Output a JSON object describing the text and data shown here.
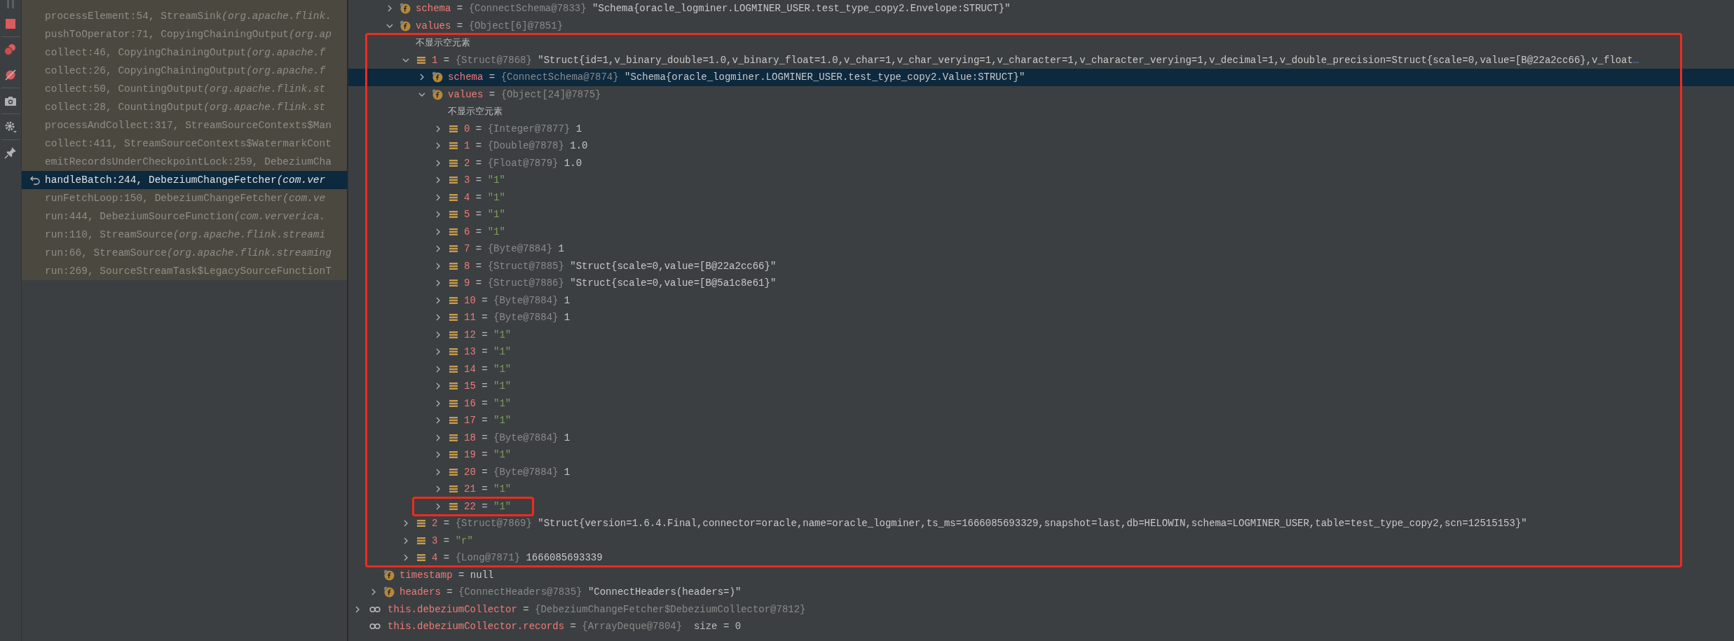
{
  "frames": [
    {
      "method": "processElement:54, StreamSink ",
      "package": "(org.apache.flink.",
      "selected": false
    },
    {
      "method": "pushToOperator:71, CopyingChainingOutput ",
      "package": "(org.ap",
      "selected": false
    },
    {
      "method": "collect:46, CopyingChainingOutput ",
      "package": "(org.apache.f",
      "selected": false
    },
    {
      "method": "collect:26, CopyingChainingOutput ",
      "package": "(org.apache.f",
      "selected": false
    },
    {
      "method": "collect:50, CountingOutput ",
      "package": "(org.apache.flink.st",
      "selected": false
    },
    {
      "method": "collect:28, CountingOutput ",
      "package": "(org.apache.flink.st",
      "selected": false
    },
    {
      "method": "processAndCollect:317, StreamSourceContexts$Man",
      "selected": false
    },
    {
      "method": "collect:411, StreamSourceContexts$WatermarkCont",
      "selected": false
    },
    {
      "method": "emitRecordsUnderCheckpointLock:259, DebeziumCha",
      "selected": false
    },
    {
      "method": "handleBatch:244, DebeziumChangeFetcher ",
      "package": "(com.ver",
      "selected": true
    },
    {
      "method": "runFetchLoop:150, DebeziumChangeFetcher ",
      "package": "(com.ve",
      "selected": false
    },
    {
      "method": "run:444, DebeziumSourceFunction ",
      "package": "(com.ververica.",
      "selected": false
    },
    {
      "method": "run:110, StreamSource ",
      "package": "(org.apache.flink.streami",
      "selected": false
    },
    {
      "method": "run:66, StreamSource ",
      "package": "(org.apache.flink.streaming",
      "selected": false
    },
    {
      "method": "run:269, SourceStreamTask$LegacySourceFunctionT",
      "selected": false
    }
  ],
  "value_fields": [
    {
      "kind": "field",
      "name": "schema",
      "sep": "=",
      "ref": "{ConnectSchema@7833}",
      "value": "\"Schema{oracle_logminer.LOGMINER_USER.test_type_copy2.Envelope:STRUCT}\"",
      "literal": false,
      "expanded": false,
      "selected": false
    },
    {
      "kind": "field",
      "name": "values",
      "sep": "=",
      "ref": "{Object[6]@7851}",
      "expanded": true,
      "selected": false,
      "note": "不显示空元素",
      "children": [
        {
          "kind": "element",
          "name": "1",
          "sep": "=",
          "ref": "{Struct@7868}",
          "value": "\"Struct{id=1,v_binary_double=1.0,v_binary_float=1.0,v_char=1,v_char_verying=1,v_character=1,v_character_verying=1,v_decimal=1,v_double_precision=Struct{scale=0,value=[B@22a2cc66},v_float",
          "more": "…",
          "literal": false,
          "expanded": true,
          "selected": false,
          "children": [
            {
              "kind": "field",
              "name": "schema",
              "sep": "=",
              "ref": "{ConnectSchema@7874}",
              "value": "\"Schema{oracle_logminer.LOGMINER_USER.test_type_copy2.Value:STRUCT}\"",
              "literal": false,
              "expanded": false,
              "selected": true
            },
            {
              "kind": "field",
              "name": "values",
              "sep": "=",
              "ref": "{Object[24]@7875}",
              "expanded": true,
              "selected": false,
              "note": "不显示空元素",
              "children": [
                {
                  "kind": "element",
                  "name": "0",
                  "sep": "=",
                  "ref": "{Integer@7877}",
                  "value": "1",
                  "literal": false,
                  "expanded": false,
                  "selected": false
                },
                {
                  "kind": "element",
                  "name": "1",
                  "sep": "=",
                  "ref": "{Double@7878}",
                  "value": "1.0",
                  "literal": false,
                  "expanded": false,
                  "selected": false
                },
                {
                  "kind": "element",
                  "name": "2",
                  "sep": "=",
                  "ref": "{Float@7879}",
                  "value": "1.0",
                  "literal": false,
                  "expanded": false,
                  "selected": false
                },
                {
                  "kind": "element",
                  "name": "3",
                  "sep": "=",
                  "value": "\"1\"",
                  "literal": true,
                  "expanded": false,
                  "selected": false
                },
                {
                  "kind": "element",
                  "name": "4",
                  "sep": "=",
                  "value": "\"1\"",
                  "literal": true,
                  "expanded": false,
                  "selected": false
                },
                {
                  "kind": "element",
                  "name": "5",
                  "sep": "=",
                  "value": "\"1\"",
                  "literal": true,
                  "expanded": false,
                  "selected": false
                },
                {
                  "kind": "element",
                  "name": "6",
                  "sep": "=",
                  "value": "\"1\"",
                  "literal": true,
                  "expanded": false,
                  "selected": false
                },
                {
                  "kind": "element",
                  "name": "7",
                  "sep": "=",
                  "ref": "{Byte@7884}",
                  "value": "1",
                  "literal": false,
                  "expanded": false,
                  "selected": false
                },
                {
                  "kind": "element",
                  "name": "8",
                  "sep": "=",
                  "ref": "{Struct@7885}",
                  "value": "\"Struct{scale=0,value=[B@22a2cc66}\"",
                  "literal": false,
                  "expanded": false,
                  "selected": false
                },
                {
                  "kind": "element",
                  "name": "9",
                  "sep": "=",
                  "ref": "{Struct@7886}",
                  "value": "\"Struct{scale=0,value=[B@5a1c8e61}\"",
                  "literal": false,
                  "expanded": false,
                  "selected": false
                },
                {
                  "kind": "element",
                  "name": "10",
                  "sep": "=",
                  "ref": "{Byte@7884}",
                  "value": "1",
                  "literal": false,
                  "expanded": false,
                  "selected": false
                },
                {
                  "kind": "element",
                  "name": "11",
                  "sep": "=",
                  "ref": "{Byte@7884}",
                  "value": "1",
                  "literal": false,
                  "expanded": false,
                  "selected": false
                },
                {
                  "kind": "element",
                  "name": "12",
                  "sep": "=",
                  "value": "\"1\"",
                  "literal": true,
                  "expanded": false,
                  "selected": false
                },
                {
                  "kind": "element",
                  "name": "13",
                  "sep": "=",
                  "value": "\"1\"",
                  "literal": true,
                  "expanded": false,
                  "selected": false
                },
                {
                  "kind": "element",
                  "name": "14",
                  "sep": "=",
                  "value": "\"1\"",
                  "literal": true,
                  "expanded": false,
                  "selected": false
                },
                {
                  "kind": "element",
                  "name": "15",
                  "sep": "=",
                  "value": "\"1\"",
                  "literal": true,
                  "expanded": false,
                  "selected": false
                },
                {
                  "kind": "element",
                  "name": "16",
                  "sep": "=",
                  "value": "\"1\"",
                  "literal": true,
                  "expanded": false,
                  "selected": false
                },
                {
                  "kind": "element",
                  "name": "17",
                  "sep": "=",
                  "value": "\"1\"",
                  "literal": true,
                  "expanded": false,
                  "selected": false
                },
                {
                  "kind": "element",
                  "name": "18",
                  "sep": "=",
                  "ref": "{Byte@7884}",
                  "value": "1",
                  "literal": false,
                  "expanded": false,
                  "selected": false
                },
                {
                  "kind": "element",
                  "name": "19",
                  "sep": "=",
                  "value": "\"1\"",
                  "literal": true,
                  "expanded": false,
                  "selected": false
                },
                {
                  "kind": "element",
                  "name": "20",
                  "sep": "=",
                  "ref": "{Byte@7884}",
                  "value": "1",
                  "literal": false,
                  "expanded": false,
                  "selected": false
                },
                {
                  "kind": "element",
                  "name": "21",
                  "sep": "=",
                  "value": "\"1\"",
                  "literal": true,
                  "expanded": false,
                  "selected": false
                },
                {
                  "kind": "element",
                  "name": "22",
                  "sep": "=",
                  "value": "\"1\"",
                  "literal": true,
                  "expanded": false,
                  "selected": false,
                  "highlighted": true
                }
              ]
            }
          ]
        },
        {
          "kind": "element",
          "name": "2",
          "sep": "=",
          "ref": "{Struct@7869}",
          "value": "\"Struct{version=1.6.4.Final,connector=oracle,name=oracle_logminer,ts_ms=1666085693329,snapshot=last,db=HELOWIN,schema=LOGMINER_USER,table=test_type_copy2,scn=12515153}\"",
          "literal": false,
          "expanded": false,
          "selected": false
        },
        {
          "kind": "element",
          "name": "3",
          "sep": "=",
          "value": "\"r\"",
          "literal": true,
          "expanded": false,
          "selected": false
        },
        {
          "kind": "element",
          "name": "4",
          "sep": "=",
          "ref": "{Long@7871}",
          "value": "1666085693339",
          "literal": false,
          "expanded": false,
          "selected": false
        }
      ]
    }
  ],
  "record_fields": [
    {
      "kind": "field",
      "name": "timestamp",
      "sep": "=",
      "value": "null",
      "literal": false,
      "selected": false
    },
    {
      "kind": "field",
      "name": "headers",
      "sep": "=",
      "ref": "{ConnectHeaders@7835}",
      "value": "\"ConnectHeaders(headers=)\"",
      "literal": false,
      "expanded": false,
      "selected": false
    }
  ],
  "locals": [
    {
      "kind": "watch",
      "name": "this.debeziumCollector",
      "sep": "=",
      "ref": "{DebeziumChangeFetcher$DebeziumCollector@7812}",
      "expanded": false,
      "selected": false
    },
    {
      "kind": "watch",
      "name": "this.debeziumCollector.records",
      "sep": "=",
      "ref": "{ArrayDeque@7804}",
      "extra": "size = 0",
      "selected": false
    }
  ]
}
